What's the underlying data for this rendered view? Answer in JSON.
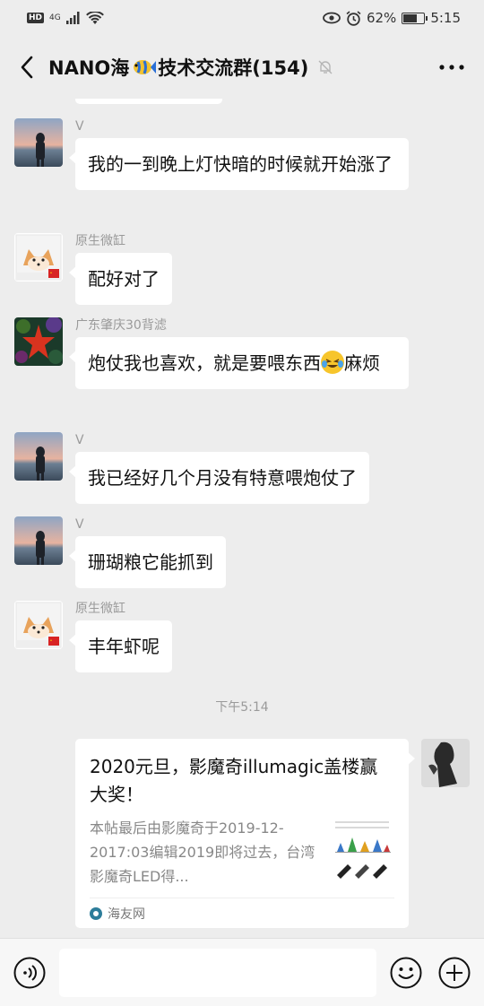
{
  "status_bar": {
    "hd": "HD",
    "network": "4G",
    "battery": "62%",
    "time": "5:15"
  },
  "header": {
    "title_prefix": "NANO海",
    "title_suffix": "技术交流群(154)",
    "back_icon": "chevron-left-icon",
    "mute_icon": "bell-off-icon",
    "more_icon": "ellipsis-icon"
  },
  "messages": [
    {
      "sender": "V",
      "text": "我的一到晚上灯快暗的时候就开始涨了"
    },
    {
      "sender": "原生微缸",
      "text": "配好对了"
    },
    {
      "sender": "广东肇庆30背滤",
      "text_before": "炮仗我也喜欢，就是要喂东西",
      "text_after": "麻烦"
    },
    {
      "sender": "V",
      "text": "我已经好几个月没有特意喂炮仗了"
    },
    {
      "sender": "V",
      "text": "珊瑚粮它能抓到"
    },
    {
      "sender": "原生微缸",
      "text": "丰年虾呢"
    }
  ],
  "time_divider": "下午5:14",
  "shared_card": {
    "title": "2020元旦，影魔奇illumagic盖楼赢大奖！",
    "description": "本帖最后由影魔奇于2019-12-2017:03编辑2019即将过去，台湾影魔奇LED得...",
    "source": "海友网"
  },
  "input_bar": {
    "voice_icon": "voice-icon",
    "emoji_icon": "smiley-icon",
    "plus_icon": "plus-icon",
    "value": ""
  }
}
